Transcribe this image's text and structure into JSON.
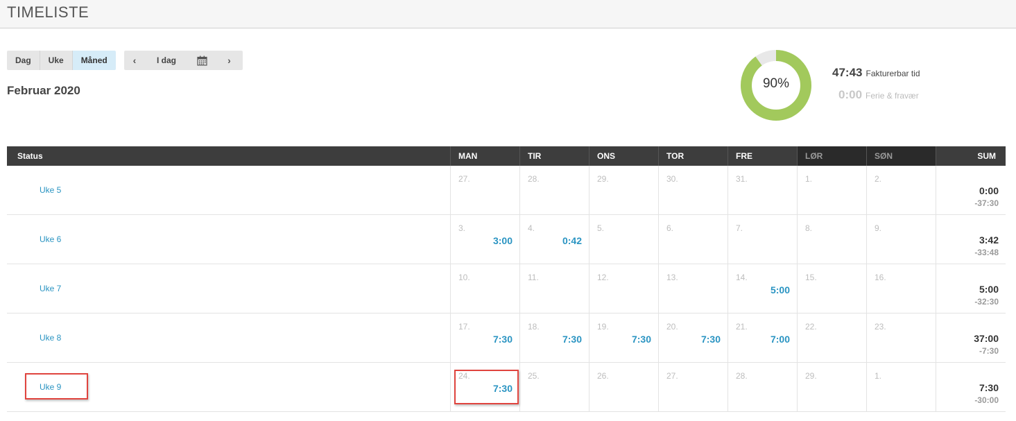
{
  "header": {
    "title": "TIMELISTE"
  },
  "view_buttons": [
    {
      "label": "Dag",
      "active": false
    },
    {
      "label": "Uke",
      "active": false
    },
    {
      "label": "Måned",
      "active": true
    }
  ],
  "nav": {
    "prev": "‹",
    "today": "I dag",
    "next": "›",
    "calendar_icon": "calendar-icon"
  },
  "month_title": "Februar 2020",
  "summary": {
    "percent_label": "90%",
    "percent_value": 90,
    "billable_value": "47:43",
    "billable_label": "Fakturerbar tid",
    "absence_value": "0:00",
    "absence_label": "Ferie & fravær"
  },
  "colors": {
    "accent": "#2a94c2",
    "donut_fill": "#a2c95c",
    "donut_track": "#e8e8e8",
    "header_bg": "#3d3d3d",
    "highlight": "#e0443e"
  },
  "grid": {
    "headers": {
      "status": "Status",
      "days": [
        "MAN",
        "TIR",
        "ONS",
        "TOR",
        "FRE",
        "LØR",
        "SØN"
      ],
      "sum": "SUM"
    },
    "rows": [
      {
        "week": "Uke 5",
        "days": [
          {
            "num": "27.",
            "hours": ""
          },
          {
            "num": "28.",
            "hours": ""
          },
          {
            "num": "29.",
            "hours": ""
          },
          {
            "num": "30.",
            "hours": ""
          },
          {
            "num": "31.",
            "hours": ""
          },
          {
            "num": "1.",
            "hours": ""
          },
          {
            "num": "2.",
            "hours": ""
          }
        ],
        "sum": "0:00",
        "diff": "-37:30"
      },
      {
        "week": "Uke 6",
        "days": [
          {
            "num": "3.",
            "hours": "3:00"
          },
          {
            "num": "4.",
            "hours": "0:42"
          },
          {
            "num": "5.",
            "hours": ""
          },
          {
            "num": "6.",
            "hours": ""
          },
          {
            "num": "7.",
            "hours": ""
          },
          {
            "num": "8.",
            "hours": ""
          },
          {
            "num": "9.",
            "hours": ""
          }
        ],
        "sum": "3:42",
        "diff": "-33:48"
      },
      {
        "week": "Uke 7",
        "days": [
          {
            "num": "10.",
            "hours": ""
          },
          {
            "num": "11.",
            "hours": ""
          },
          {
            "num": "12.",
            "hours": ""
          },
          {
            "num": "13.",
            "hours": ""
          },
          {
            "num": "14.",
            "hours": "5:00"
          },
          {
            "num": "15.",
            "hours": ""
          },
          {
            "num": "16.",
            "hours": ""
          }
        ],
        "sum": "5:00",
        "diff": "-32:30"
      },
      {
        "week": "Uke 8",
        "days": [
          {
            "num": "17.",
            "hours": "7:30"
          },
          {
            "num": "18.",
            "hours": "7:30"
          },
          {
            "num": "19.",
            "hours": "7:30"
          },
          {
            "num": "20.",
            "hours": "7:30"
          },
          {
            "num": "21.",
            "hours": "7:00"
          },
          {
            "num": "22.",
            "hours": ""
          },
          {
            "num": "23.",
            "hours": ""
          }
        ],
        "sum": "37:00",
        "diff": "-7:30"
      },
      {
        "week": "Uke 9",
        "days": [
          {
            "num": "24.",
            "hours": "7:30"
          },
          {
            "num": "25.",
            "hours": ""
          },
          {
            "num": "26.",
            "hours": ""
          },
          {
            "num": "27.",
            "hours": ""
          },
          {
            "num": "28.",
            "hours": ""
          },
          {
            "num": "29.",
            "hours": ""
          },
          {
            "num": "1.",
            "hours": ""
          }
        ],
        "sum": "7:30",
        "diff": "-30:00"
      }
    ]
  }
}
